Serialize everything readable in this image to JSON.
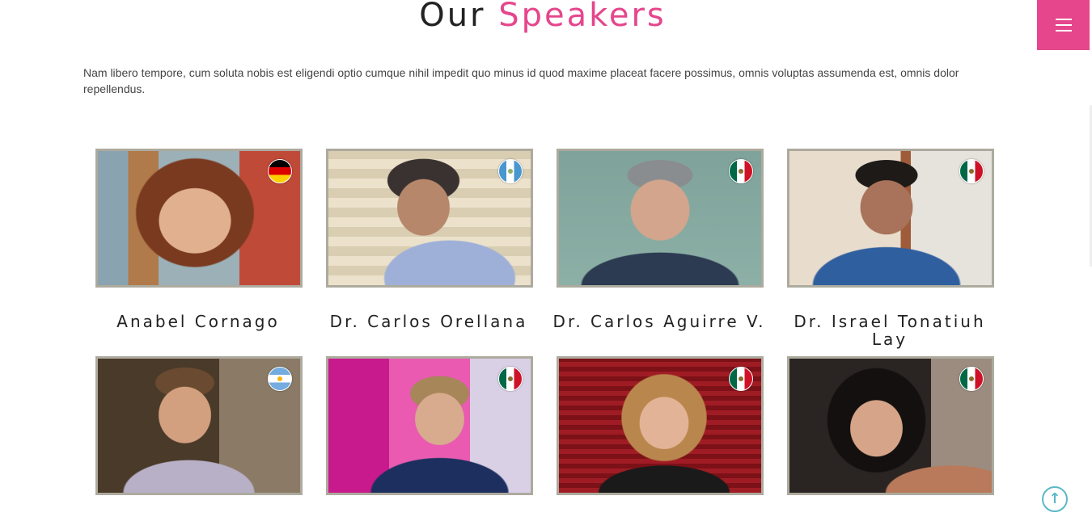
{
  "header": {
    "title_main": "Our",
    "title_accent": "Speakers",
    "menu_icon": "hamburger-icon",
    "accent_color": "#e5468c"
  },
  "intro": "Nam libero tempore, cum soluta nobis est eligendi optio cumque nihil impedit quo minus id quod maxime placeat facere possimus, omnis voluptas assumenda est, omnis dolor repellendus.",
  "speakers": [
    {
      "name": "Anabel Cornago",
      "flag": "Germany"
    },
    {
      "name": "Dr. Carlos Orellana",
      "flag": "Guatemala"
    },
    {
      "name": "Dr. Carlos Aguirre V.",
      "flag": "Mexico"
    },
    {
      "name": "Dr. Israel Tonatiuh Lay",
      "flag": "Mexico"
    },
    {
      "name": "",
      "flag": "Argentina"
    },
    {
      "name": "",
      "flag": "Mexico"
    },
    {
      "name": "",
      "flag": "Mexico"
    },
    {
      "name": "",
      "flag": "Mexico"
    }
  ],
  "scroll_top_icon": "arrow-up-circle-icon"
}
